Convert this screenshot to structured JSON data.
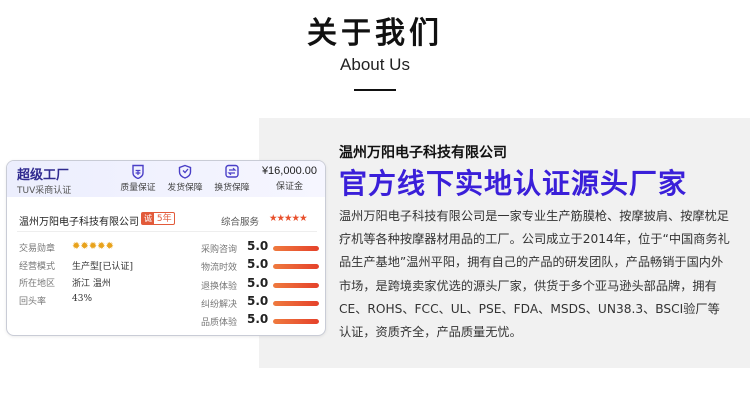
{
  "header": {
    "title": "关于我们",
    "subtitle": "About Us"
  },
  "card": {
    "tier": "超级工厂",
    "tier_sub": "TUV采商认证",
    "badges": [
      {
        "icon": "quality-icon",
        "label": "质量保证"
      },
      {
        "icon": "shipping-icon",
        "label": "发货保障"
      },
      {
        "icon": "exchange-icon",
        "label": "换货保障"
      }
    ],
    "deposit": {
      "amount": "¥16,000.00",
      "label": "保证金"
    },
    "company_name": "温州万阳电子科技有限公司",
    "years_tag": "诚",
    "years_value": "5年",
    "service_label": "综合服务",
    "service_stars": "★★★★★",
    "info": [
      {
        "key": "交易勋章",
        "value": "",
        "medals": "✹✹✹✹✹"
      },
      {
        "key": "经营模式",
        "value": "生产型[已认证]"
      },
      {
        "key": "所在地区",
        "value": "浙江 温州"
      },
      {
        "key": "回头率",
        "value": "43%"
      }
    ],
    "scores": [
      {
        "key": "采购咨询",
        "value": "5.0",
        "level": 1.0
      },
      {
        "key": "物流时效",
        "value": "5.0",
        "level": 1.0
      },
      {
        "key": "退换体验",
        "value": "5.0",
        "level": 1.0
      },
      {
        "key": "纠纷解决",
        "value": "5.0",
        "level": 1.0
      },
      {
        "key": "品质体验",
        "value": "5.0",
        "level": 1.0
      }
    ]
  },
  "about": {
    "company": "温州万阳电子科技有限公司",
    "slogan": "官方线下实地认证源头厂家",
    "description": "温州万阳电子科技有限公司是一家专业生产筋膜枪、按摩披肩、按摩枕足疗机等各种按摩器材用品的工厂。公司成立于2014年，位于“中国商务礼品生产基地”温州平阳，拥有自己的产品的研发团队，产品畅销于国内外市场，是跨境卖家优选的源头厂家，供货于多个亚马逊头部品牌，拥有CE、ROHS、FCC、UL、PSE、FDA、MSDS、UN38.3、BSCI验厂等认证，资质齐全，产品质量无忧。"
  },
  "colors": {
    "accent": "#3a1fd9",
    "bar": "#e5412a",
    "star": "#e8502c",
    "medal": "#e8a21b"
  }
}
